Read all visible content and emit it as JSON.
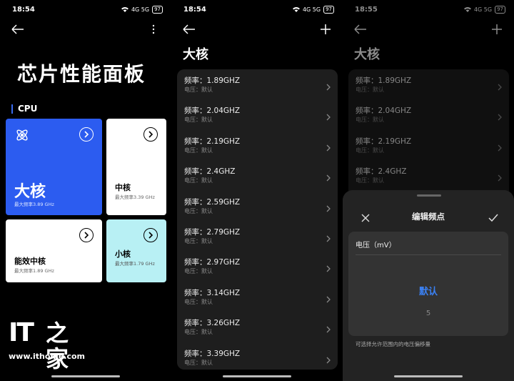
{
  "screen1": {
    "time": "18:54",
    "battery": "97",
    "network": "4G 5G",
    "title": "芯片性能面板",
    "section_label": "CPU",
    "cards": {
      "big": {
        "name": "大核",
        "sub": "最大频率3.89 GHz",
        "color": "#2c5cf0"
      },
      "mid": {
        "name": "中核",
        "sub": "最大频率3.39 GHz",
        "color": "#ffffff"
      },
      "efficiency": {
        "name": "能效中核",
        "sub": "最大频率1.89 GHz",
        "color": "#ffffff"
      },
      "small": {
        "name": "小核",
        "sub": "最大频率1.79 GHz",
        "color": "#b8f0f4"
      }
    },
    "watermark": {
      "logo": "IT",
      "logo_zh": "之家",
      "url": "www.ithome.com"
    }
  },
  "screen2": {
    "time": "18:54",
    "battery": "97",
    "network": "4G 5G",
    "title": "大核",
    "rows": [
      {
        "freq": "频率：1.89GHZ",
        "volt": "电压：默认"
      },
      {
        "freq": "频率：2.04GHZ",
        "volt": "电压：默认"
      },
      {
        "freq": "频率：2.19GHZ",
        "volt": "电压：默认"
      },
      {
        "freq": "频率：2.4GHZ",
        "volt": "电压：默认"
      },
      {
        "freq": "频率：2.59GHZ",
        "volt": "电压：默认"
      },
      {
        "freq": "频率：2.79GHZ",
        "volt": "电压：默认"
      },
      {
        "freq": "频率：2.97GHZ",
        "volt": "电压：默认"
      },
      {
        "freq": "频率：3.14GHZ",
        "volt": "电压：默认"
      },
      {
        "freq": "频率：3.26GHZ",
        "volt": "电压：默认"
      },
      {
        "freq": "频率：3.39GHZ",
        "volt": "电压：默认"
      }
    ]
  },
  "screen3": {
    "time": "18:55",
    "battery": "97",
    "network": "4G 5G",
    "title": "大核",
    "rows": [
      {
        "freq": "频率：1.89GHZ",
        "volt": "电压：默认"
      },
      {
        "freq": "频率：2.04GHZ",
        "volt": "电压：默认"
      },
      {
        "freq": "频率：2.19GHZ",
        "volt": "电压：默认"
      },
      {
        "freq": "频率：2.4GHZ",
        "volt": "电压：默认"
      }
    ],
    "sheet": {
      "title": "编辑频点",
      "voltage_label": "电压（mV）",
      "selected": "默认",
      "next_option": "5",
      "hint": "可选择允许范围内的电压偏移量",
      "accent": "#3b82f6"
    }
  }
}
